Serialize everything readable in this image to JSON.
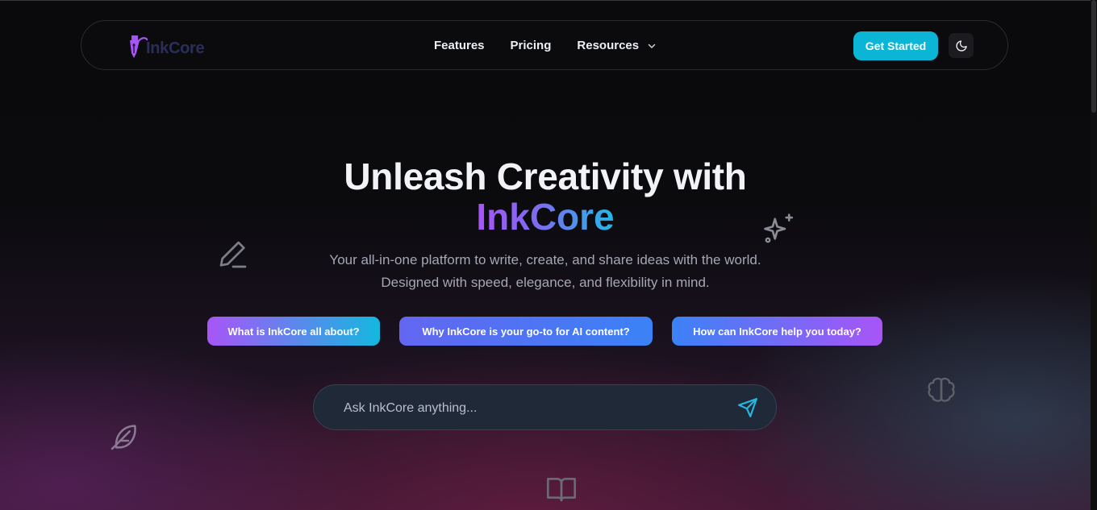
{
  "nav": {
    "logo_text": "InkCore",
    "links": [
      {
        "label": "Features"
      },
      {
        "label": "Pricing"
      },
      {
        "label": "Resources"
      }
    ],
    "cta_label": "Get Started",
    "theme_icon": "moon-icon"
  },
  "hero": {
    "title_line1": "Unleash Creativity with",
    "title_brand": "InkCore",
    "subtitle_line1": "Your all-in-one platform to write, create, and share ideas with the world.",
    "subtitle_line2": "Designed with speed, elegance, and flexibility in mind."
  },
  "suggestions": [
    {
      "label": "What is InkCore all about?"
    },
    {
      "label": "Why InkCore is your go-to for AI content?"
    },
    {
      "label": "How can InkCore help you today?"
    }
  ],
  "ask": {
    "placeholder": "Ask InkCore anything...",
    "send_icon": "send-icon"
  },
  "colors": {
    "accent_cyan": "#0bb5d6",
    "brand_purple": "#a855f7",
    "brand_blue": "#3b82f6"
  },
  "decorations": [
    "pen-icon",
    "sparkles-icon",
    "brain-icon",
    "feather-icon",
    "book-icon"
  ]
}
